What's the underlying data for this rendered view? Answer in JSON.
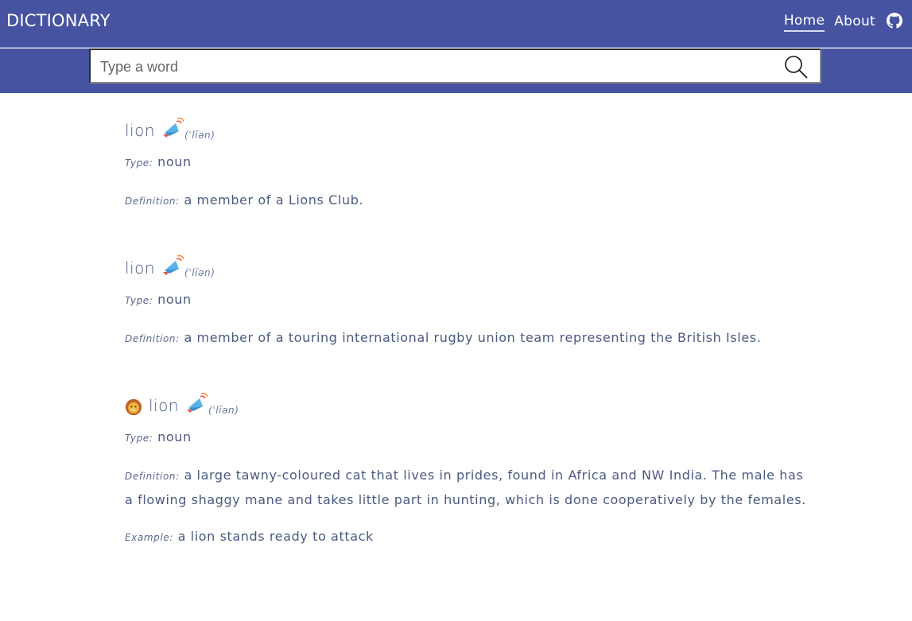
{
  "header": {
    "brand": "DICTIONARY",
    "nav": [
      {
        "label": "Home",
        "active": true
      },
      {
        "label": "About",
        "active": false
      }
    ],
    "github_icon": "github-icon"
  },
  "search": {
    "placeholder": "Type a word",
    "value": "",
    "button_icon": "search-icon"
  },
  "labels": {
    "type": "Type:",
    "definition": "Definition:",
    "example": "Example:"
  },
  "entries": [
    {
      "emoji": "",
      "word": "lion",
      "phonetic": "(ˈlīən)",
      "type": "noun",
      "definition": "a member of a Lions Club.",
      "example": ""
    },
    {
      "emoji": "",
      "word": "lion",
      "phonetic": "(ˈlīən)",
      "type": "noun",
      "definition": "a member of a touring international rugby union team representing the British Isles.",
      "example": ""
    },
    {
      "emoji": "lion-face-emoji",
      "word": "lion",
      "phonetic": "(ˈlīən)",
      "type": "noun",
      "definition": "a large tawny-coloured cat that lives in prides, found in Africa and NW India. The male has a flowing shaggy mane and takes little part in hunting, which is done cooperatively by the females.",
      "example": "a lion stands ready to attack"
    }
  ],
  "colors": {
    "header_bg": "#4553a0",
    "text": "#4a5a80"
  }
}
